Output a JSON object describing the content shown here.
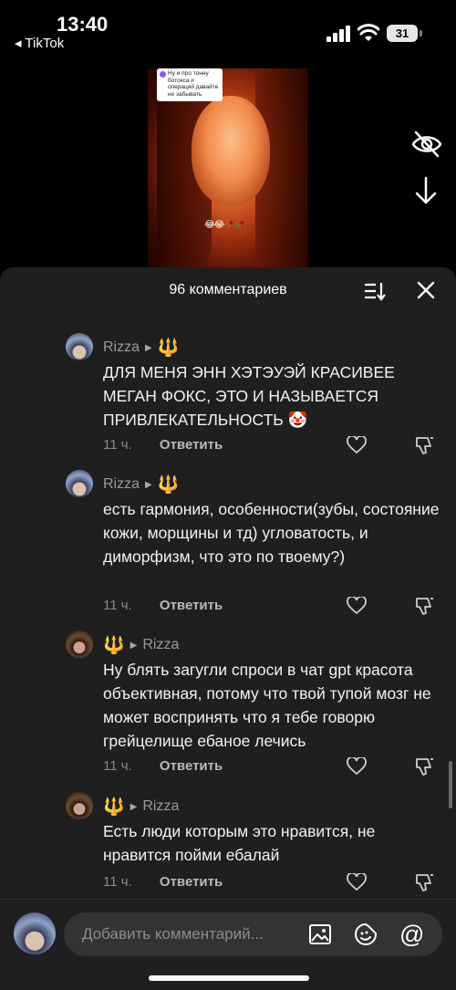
{
  "status": {
    "time": "13:40",
    "back_app": "◂ TikTok",
    "battery": "31"
  },
  "video": {
    "caption_bubble": "Ну и про тонну ботокса и операций давайте не забывать",
    "emojis": "😂😂🥀🥀"
  },
  "sheet": {
    "title": "96 комментариев"
  },
  "comments": [
    {
      "author": "Rizza",
      "reply_to": "🔱",
      "text": "ДЛЯ МЕНЯ ЭНН ХЭТЭУЭЙ КРАСИВЕЕ МЕГАН ФОКС, ЭТО И НАЗЫВАЕТСЯ ПРИВЛЕКАТЕЛЬНОСТЬ 🤡",
      "time": "11 ч.",
      "reply_label": "Ответить"
    },
    {
      "author": "Rizza",
      "reply_to": "🔱",
      "text": "есть гармония, особенности(зубы, состояние кожи, морщины и тд) угловатость, и диморфизм, что это по твоему?)",
      "time": "11 ч.",
      "reply_label": "Ответить"
    },
    {
      "author": "🔱",
      "reply_to": "Rizza",
      "text": "Ну блять загугли спроси в чат gpt красота объективная, потому что твой тупой мозг не может воспринять что я тебе говорю грейцелище ебаное лечись",
      "time": "11 ч.",
      "reply_label": "Ответить"
    },
    {
      "author": "🔱",
      "reply_to": "Rizza",
      "text": "Есть люди которым это нравится, не нравится пойми ебалай",
      "time": "11 ч.",
      "reply_label": "Ответить"
    }
  ],
  "composer": {
    "placeholder": "Добавить комментарий..."
  },
  "colors": {
    "sheet_bg": "#1f1f1f",
    "accent_trident": "#e6a21a",
    "muted": "#8a8a8a"
  }
}
